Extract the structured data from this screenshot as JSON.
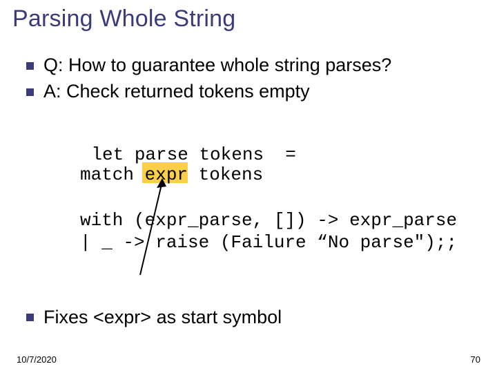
{
  "title": "Parsing Whole String",
  "bullets": {
    "q": "Q: How to guarantee whole string parses?",
    "a": "A: Check returned tokens empty"
  },
  "highlight_word": "expr",
  "code": {
    "l1": "let parse tokens  =",
    "l2": "match expr tokens",
    "l3": "with (expr_parse, []) -> expr_parse",
    "l4": "| _ -> raise (Failure “No parse\");;"
  },
  "closing": "Fixes <expr> as start symbol",
  "footer": {
    "date": "10/7/2020",
    "page": "70"
  }
}
